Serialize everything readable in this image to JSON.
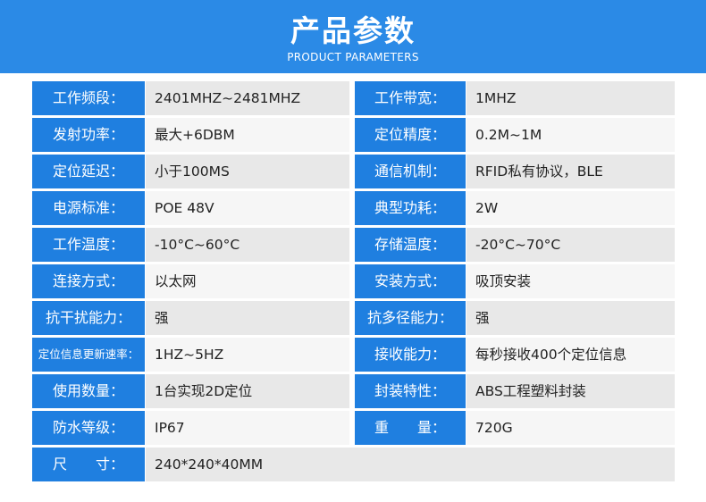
{
  "header": {
    "title": "产品参数",
    "subtitle": "PRODUCT PARAMETERS"
  },
  "rows": [
    {
      "l1": "工作频段：",
      "v1": "2401MHZ~2481MHZ",
      "l2": "工作带宽：",
      "v2": "1MHZ"
    },
    {
      "l1": "发射功率：",
      "v1": "最大+6DBM",
      "l2": "定位精度：",
      "v2": "0.2M~1M"
    },
    {
      "l1": "定位延迟：",
      "v1": "小于100MS",
      "l2": "通信机制：",
      "v2": "RFID私有协议，BLE"
    },
    {
      "l1": "电源标准：",
      "v1": "POE 48V",
      "l2": "典型功耗：",
      "v2": "2W"
    },
    {
      "l1": "工作温度：",
      "v1": "-10°C~60°C",
      "l2": "存储温度：",
      "v2": "-20°C~70°C"
    },
    {
      "l1": "连接方式：",
      "v1": "以太网",
      "l2": "安装方式：",
      "v2": "吸顶安装"
    },
    {
      "l1": "抗干扰能力：",
      "v1": "强",
      "l2": "抗多径能力：",
      "v2": "强"
    },
    {
      "l1": "定位信息更新速率：",
      "v1": "1HZ~5HZ",
      "l2": "接收能力：",
      "v2": "每秒接收400个定位信息"
    },
    {
      "l1": "使用数量：",
      "v1": "1台实现2D定位",
      "l2": "封装特性：",
      "v2": "ABS工程塑料封装"
    },
    {
      "l1": "防水等级：",
      "v1": "IP67",
      "l2": "重　　量：",
      "v2": "720G"
    },
    {
      "l1": "尺　　寸：",
      "v1": "240*240*40MM"
    }
  ],
  "colors": {
    "banner": "#2b8ae6",
    "label_bg": "#1f7fe0",
    "value_bg_dark": "#e8e8e8",
    "value_bg_light": "#f6f6f6"
  }
}
